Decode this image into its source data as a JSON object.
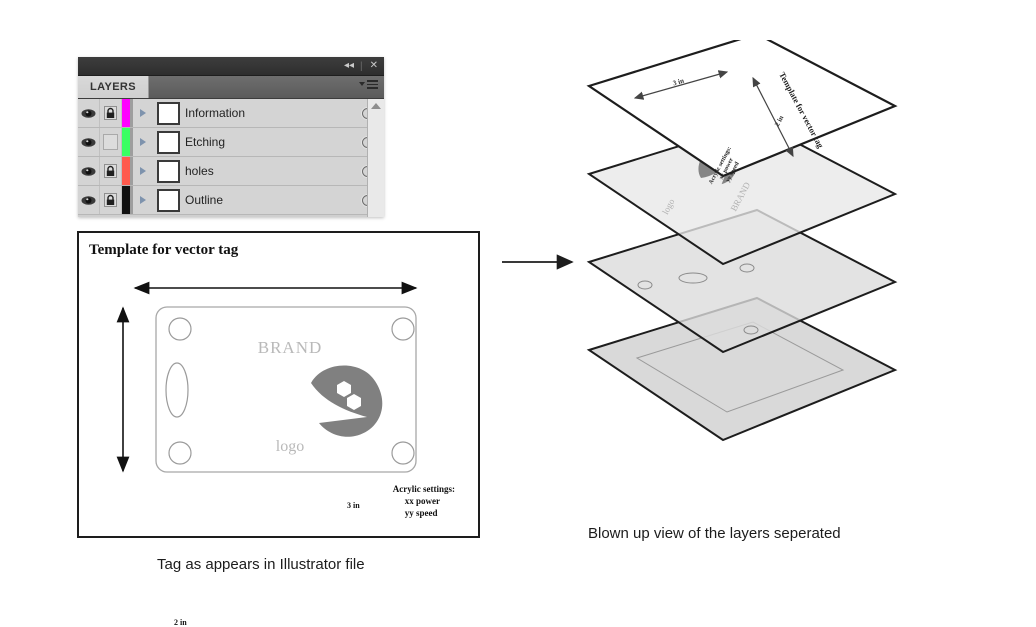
{
  "panel": {
    "title_tab": "LAYERS",
    "collapse_icon": "double-left-arrow-icon",
    "close_icon": "close-icon",
    "menu_icon": "panel-menu-icon",
    "separator": "|",
    "collapse_glyph": "◂◂",
    "close_glyph": "✕",
    "rows": [
      {
        "name": "Information",
        "color": "#ff00ff",
        "visible": true,
        "locked": true,
        "thumb": "information-thumb"
      },
      {
        "name": "Etching",
        "color": "#39ff62",
        "visible": true,
        "locked": false,
        "thumb": "etching-thumb"
      },
      {
        "name": "holes",
        "color": "#ff5a4d",
        "visible": true,
        "locked": true,
        "thumb": "holes-thumb"
      },
      {
        "name": "Outline",
        "color": "#111111",
        "visible": true,
        "locked": true,
        "thumb": "outline-thumb"
      }
    ]
  },
  "template": {
    "title": "Template for vector tag",
    "dim_horizontal": "3 in",
    "dim_vertical": "2 in",
    "brand_label": "BRAND",
    "logo_label": "logo",
    "settings_title": "Acrylic settings:",
    "settings_line1": "xx power",
    "settings_line2": "yy speed"
  },
  "exploded": {
    "layer_title": "Template for vector tag",
    "brand_label": "BRAND",
    "logo_label": "logo",
    "settings_title": "Acrylic settings:",
    "settings_line1": "xx power",
    "settings_line2": "yy speed",
    "dim_horizontal": "3 in",
    "dim_vertical": "2 in"
  },
  "captions": {
    "left": "Tag as appears in Illustrator file",
    "right": "Blown up view of the layers seperated"
  },
  "colors": {
    "background": "#ffffff",
    "panel_body": "#d4d4d4",
    "panel_titlebar": "#333333",
    "ink": "#1d1d1d",
    "logo_gray": "#808080",
    "label_gray": "#b9b9b9"
  }
}
